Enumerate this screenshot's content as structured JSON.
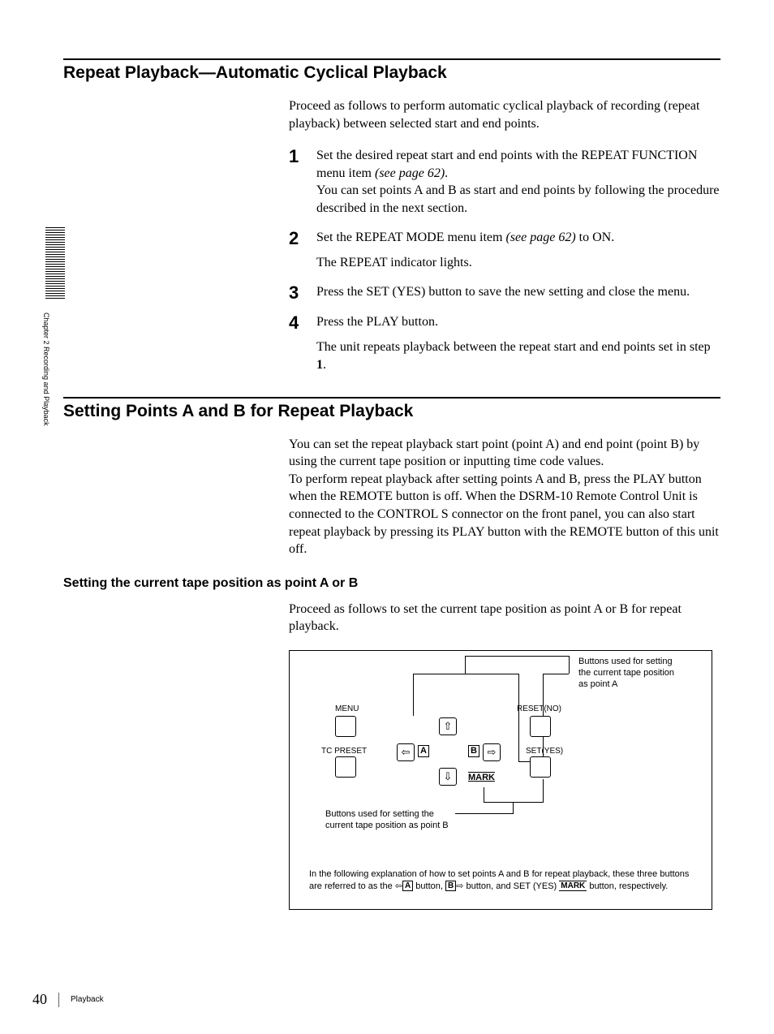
{
  "sidebar": {
    "chapter_label": "Chapter 2   Recording and Playback"
  },
  "section1": {
    "heading": "Repeat Playback—Automatic Cyclical Playback",
    "intro": "Proceed as follows to perform automatic cyclical playback of recording (repeat playback) between selected start and end points.",
    "steps": {
      "n1": "1",
      "s1a": "Set the desired repeat start and end points with the REPEAT FUNCTION menu item ",
      "s1b": "(see page 62)",
      "s1c": ".",
      "s1d": "You can set points A and B as start and end points by following the procedure described in the next section.",
      "n2": "2",
      "s2a": "Set the REPEAT MODE menu item ",
      "s2b": "(see page 62)",
      "s2c": " to ON.",
      "s2d": "The REPEAT indicator lights.",
      "n3": "3",
      "s3": "Press the SET (YES) button to save the new setting and close the menu.",
      "n4": "4",
      "s4": "Press the PLAY button.",
      "s4b_a": "The unit repeats playback between the repeat start and end points set in step ",
      "s4b_b": "1",
      "s4b_c": "."
    }
  },
  "section2": {
    "heading": "Setting Points A and B for Repeat Playback",
    "p1": "You can set the repeat playback start point (point A) and end point (point B) by using the current tape position or inputting time code values.",
    "p2": "To perform repeat playback after setting points A and B, press the PLAY button when the REMOTE button is off. When the DSRM-10 Remote Control Unit is connected to the CONTROL S connector on the front panel, you can also start repeat playback by pressing its PLAY button with the REMOTE button of this unit off.",
    "subheading": "Setting the current tape position as point A or B",
    "p3": "Proceed as follows to set the current tape position as point A or B for repeat playback."
  },
  "diagram": {
    "labels": {
      "menu": "MENU",
      "reset": "RESET(NO)",
      "tc": "TC PRESET",
      "set": "SET(YES)",
      "A": "A",
      "B": "B",
      "mark": "MARK",
      "up": "⇧",
      "down": "⇩",
      "left": "⇦",
      "right": "⇨"
    },
    "callout_a": "Buttons used for setting the current tape position as point A",
    "callout_b": "Buttons used for setting the current tape position as point B",
    "note_a": "In the following explanation of how to set points A and B for repeat playback, these three buttons are referred to as the ",
    "note_b": " button, ",
    "note_c": " button, and SET (YES) ",
    "note_d": " button, respectively.",
    "key_a": "A",
    "key_b": "B",
    "key_mark": "MARK",
    "arr_l": "⇦",
    "arr_r": "⇨"
  },
  "footer": {
    "page": "40",
    "title": "Playback"
  }
}
